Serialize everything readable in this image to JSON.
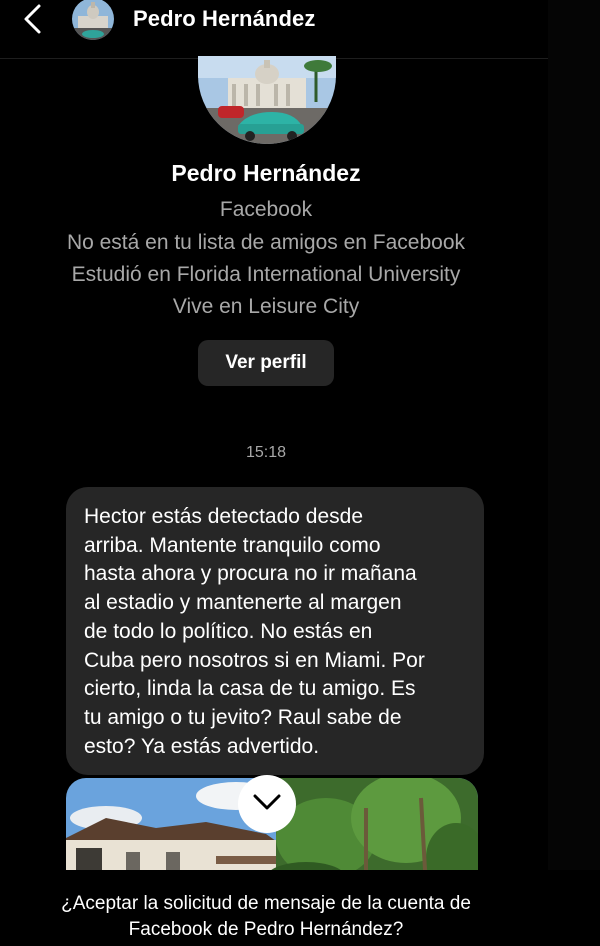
{
  "header": {
    "back_icon": "chevron-left-icon",
    "name": "Pedro Hernández"
  },
  "profile": {
    "name": "Pedro Hernández",
    "source": "Facebook",
    "friends_status": "No está en tu lista de amigos en Facebook",
    "education": "Estudió en Florida International University",
    "location": "Vive en Leisure City",
    "view_profile_label": "Ver perfil"
  },
  "conversation": {
    "timestamp": "15:18",
    "messages": [
      {
        "text": "Hector estás detectado desde\narriba. Mantente tranquilo como\nhasta ahora y procura no ir mañana\nal estadio y mantenerte al margen\nde todo lo político. No estás en\nCuba pero nosotros si en Miami. Por\ncierto, linda la casa de tu amigo. Es\ntu amigo o tu jevito? Raul sabe de\nesto? Ya estás advertido."
      }
    ],
    "scroll_down_icon": "chevron-down-icon"
  },
  "footer": {
    "request_text": "¿Aceptar la solicitud de mensaje de la cuenta de\nFacebook de Pedro Hernández?"
  },
  "colors": {
    "background": "#000000",
    "bubble": "#262626",
    "secondary_text": "#a8a8a8"
  }
}
